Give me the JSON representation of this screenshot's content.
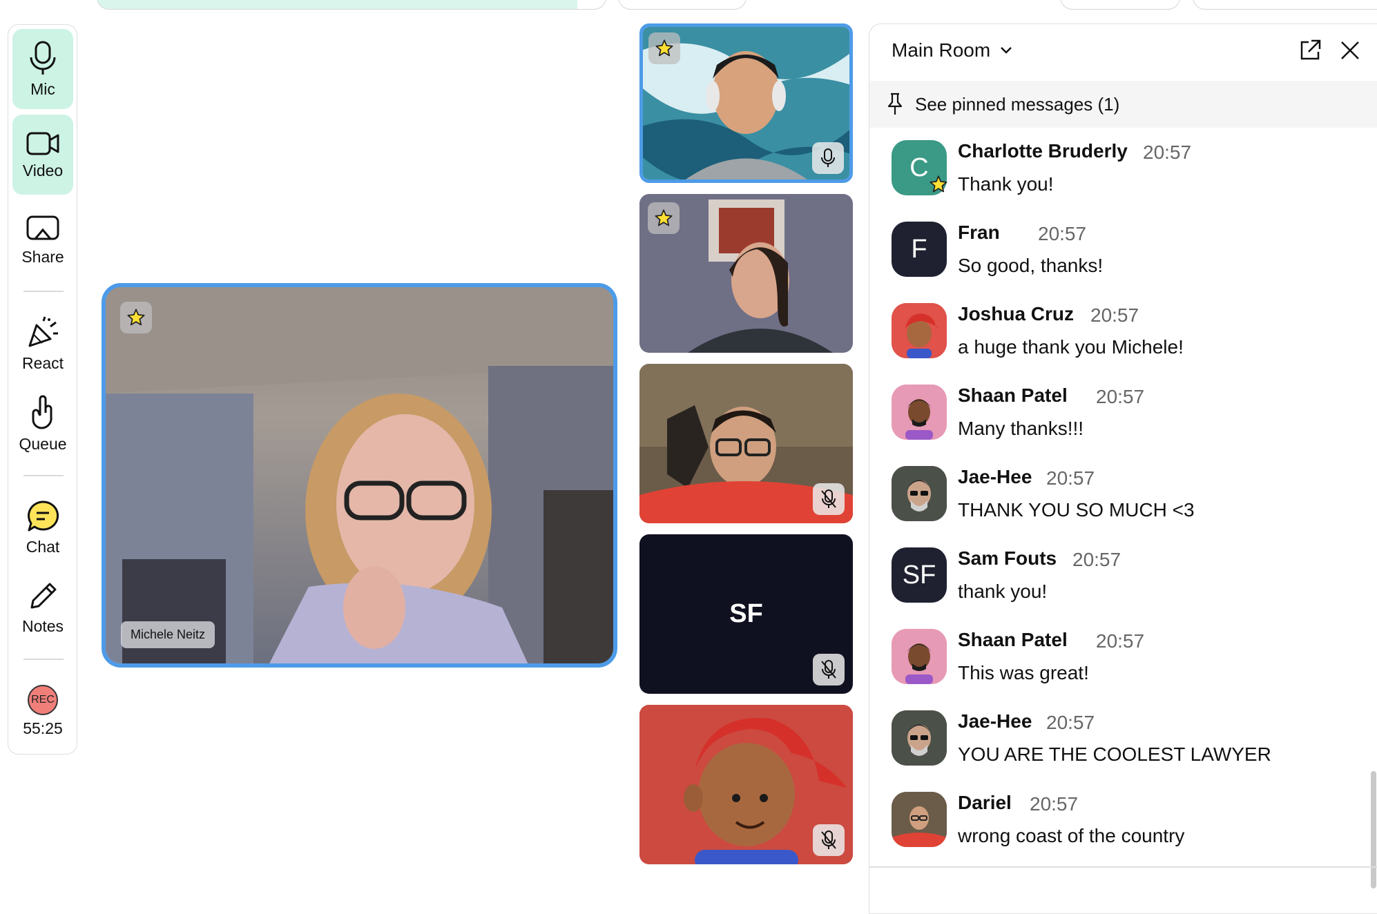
{
  "toolbar": {
    "mic_label": "Mic",
    "video_label": "Video",
    "share_label": "Share",
    "react_label": "React",
    "queue_label": "Queue",
    "chat_label": "Chat",
    "notes_label": "Notes",
    "rec_label": "REC",
    "rec_time": "55:25"
  },
  "stage": {
    "speaker_name": "Michele Neitz"
  },
  "tiles": [
    {
      "id": "tile-1",
      "starred": true,
      "mic": "on"
    },
    {
      "id": "tile-2",
      "starred": true,
      "mic": "none"
    },
    {
      "id": "tile-3",
      "starred": false,
      "mic": "muted"
    },
    {
      "id": "tile-4",
      "initials": "SF",
      "starred": false,
      "mic": "muted"
    },
    {
      "id": "tile-5",
      "starred": false,
      "mic": "muted"
    }
  ],
  "chat": {
    "room_name": "Main Room",
    "pinned_label": "See pinned messages (1)",
    "messages": [
      {
        "name": "Charlotte Bruderly",
        "time": "20:57",
        "text": "Thank you!",
        "avatar": "C"
      },
      {
        "name": "Fran",
        "time": "20:57",
        "text": "So good, thanks!",
        "avatar": "F"
      },
      {
        "name": "Joshua Cruz",
        "time": "20:57",
        "text": "a huge thank you Michele!",
        "avatar": ""
      },
      {
        "name": "Shaan Patel",
        "time": "20:57",
        "text": "Many thanks!!!",
        "avatar": ""
      },
      {
        "name": "Jae-Hee",
        "time": "20:57",
        "text": "THANK YOU SO MUCH <3",
        "avatar": ""
      },
      {
        "name": "Sam Fouts",
        "time": "20:57",
        "text": "thank you!",
        "avatar": "SF"
      },
      {
        "name": "Shaan Patel",
        "time": "20:57",
        "text": "This was great!",
        "avatar": ""
      },
      {
        "name": "Jae-Hee",
        "time": "20:57",
        "text": "YOU ARE THE COOLEST LAWYER",
        "avatar": ""
      },
      {
        "name": "Dariel",
        "time": "20:57",
        "text": "wrong coast of the country",
        "avatar": ""
      }
    ]
  },
  "colors": {
    "accent_mint": "#cdf3e5",
    "speaking_border": "#4d9be8",
    "rec_red": "#f07f7a",
    "dark_avatar": "#1f2130",
    "teal_avatar": "#3a9a85"
  }
}
